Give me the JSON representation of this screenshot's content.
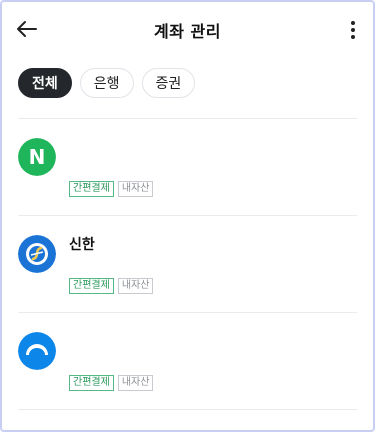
{
  "header": {
    "back_icon": "arrow-left-icon",
    "title": "계좌 관리",
    "more_icon": "more-vertical-icon"
  },
  "filters": [
    {
      "label": "전체",
      "selected": true
    },
    {
      "label": "은행",
      "selected": false
    },
    {
      "label": "증권",
      "selected": false
    }
  ],
  "accounts": [
    {
      "logo_icon": "naver-logo-icon",
      "logo_letter": "N",
      "logo_color": "#1fb65b",
      "name": "",
      "tags": [
        "간편결제",
        "내자산"
      ]
    },
    {
      "logo_icon": "shinhan-logo-icon",
      "logo_color": "#1b73d6",
      "name": "신한",
      "tags": [
        "간편결제",
        "내자산"
      ]
    },
    {
      "logo_icon": "blue-bank-logo-icon",
      "logo_color": "#0c86e8",
      "name": "",
      "tags": [
        "간편결제",
        "내자산"
      ]
    }
  ]
}
